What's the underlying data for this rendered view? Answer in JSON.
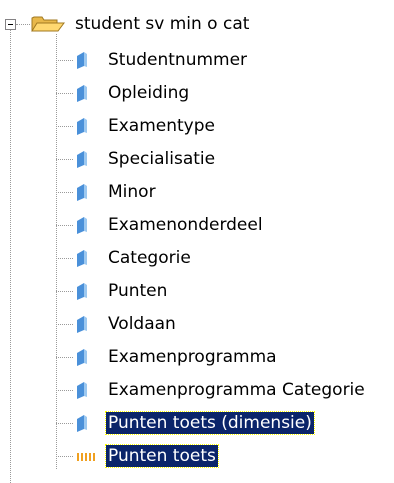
{
  "tree": {
    "root": {
      "label": "student sv min o cat",
      "icon": "open-folder-icon",
      "expanded": true
    },
    "children": [
      {
        "label": "Studentnummer",
        "icon": "dimension-icon",
        "selected": false
      },
      {
        "label": "Opleiding",
        "icon": "dimension-icon",
        "selected": false
      },
      {
        "label": "Examentype",
        "icon": "dimension-icon",
        "selected": false
      },
      {
        "label": "Specialisatie",
        "icon": "dimension-icon",
        "selected": false
      },
      {
        "label": "Minor",
        "icon": "dimension-icon",
        "selected": false
      },
      {
        "label": "Examenonderdeel",
        "icon": "dimension-icon",
        "selected": false
      },
      {
        "label": "Categorie",
        "icon": "dimension-icon",
        "selected": false
      },
      {
        "label": "Punten",
        "icon": "dimension-icon",
        "selected": false
      },
      {
        "label": "Voldaan",
        "icon": "dimension-icon",
        "selected": false
      },
      {
        "label": "Examenprogramma",
        "icon": "dimension-icon",
        "selected": false
      },
      {
        "label": "Examenprogramma Categorie",
        "icon": "dimension-icon",
        "selected": false
      },
      {
        "label": "Punten toets (dimensie)",
        "icon": "dimension-icon",
        "selected": true
      },
      {
        "label": "Punten toets",
        "icon": "measure-icon",
        "selected": true
      }
    ]
  },
  "colors": {
    "selection_bg": "#0a246a",
    "selection_text": "#ffffff",
    "connector": "#9a9a9a",
    "dimension_icon": "#4a90d9",
    "measure_icon": "#f0a020"
  }
}
